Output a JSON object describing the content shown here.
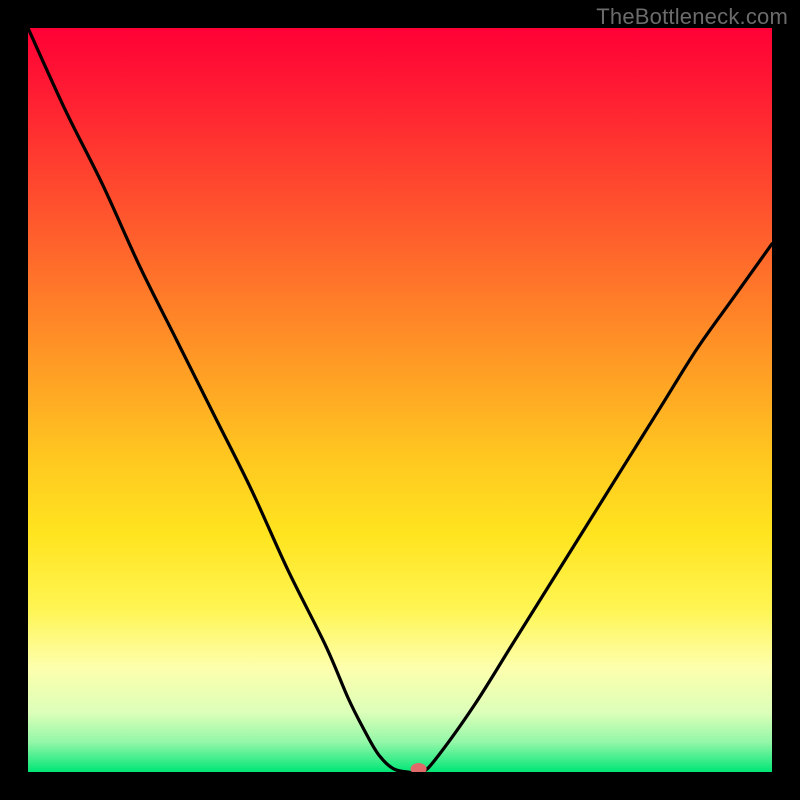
{
  "watermark": "TheBottleneck.com",
  "chart_data": {
    "type": "line",
    "title": "",
    "xlabel": "",
    "ylabel": "",
    "xlim": [
      0,
      100
    ],
    "ylim": [
      0,
      100
    ],
    "x": [
      0,
      5,
      10,
      15,
      20,
      25,
      30,
      35,
      40,
      43,
      45,
      47,
      49,
      51,
      53,
      55,
      60,
      65,
      70,
      75,
      80,
      85,
      90,
      95,
      100
    ],
    "values": [
      100,
      89,
      79,
      68,
      58,
      48,
      38,
      27,
      17,
      10,
      6,
      2.5,
      0.5,
      0,
      0,
      2,
      9,
      17,
      25,
      33,
      41,
      49,
      57,
      64,
      71
    ],
    "marker": {
      "x": 52.5,
      "y": 0
    },
    "gradient_stops": [
      {
        "offset": 0.0,
        "color": "#ff0036"
      },
      {
        "offset": 0.08,
        "color": "#ff1a33"
      },
      {
        "offset": 0.18,
        "color": "#ff3d2f"
      },
      {
        "offset": 0.28,
        "color": "#ff5f2c"
      },
      {
        "offset": 0.38,
        "color": "#ff8228"
      },
      {
        "offset": 0.48,
        "color": "#ffa524"
      },
      {
        "offset": 0.58,
        "color": "#ffc820"
      },
      {
        "offset": 0.68,
        "color": "#ffe41f"
      },
      {
        "offset": 0.78,
        "color": "#fff552"
      },
      {
        "offset": 0.86,
        "color": "#fdffad"
      },
      {
        "offset": 0.92,
        "color": "#dcffb9"
      },
      {
        "offset": 0.96,
        "color": "#93f7a8"
      },
      {
        "offset": 1.0,
        "color": "#00e676"
      }
    ]
  }
}
